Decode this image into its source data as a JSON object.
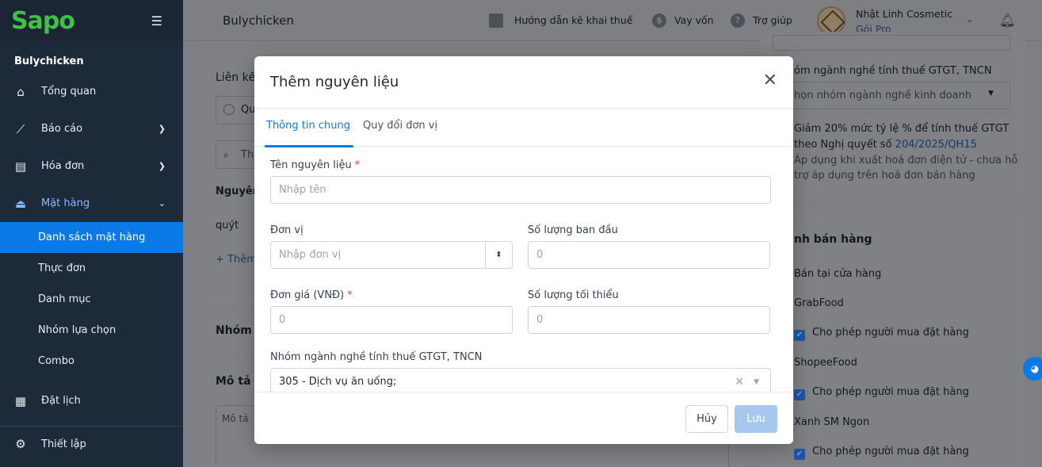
{
  "sidebar": {
    "logo": "Sapo",
    "store_name": "Bulychicken",
    "items": [
      {
        "label": "Tổng quan",
        "icon": "home-icon"
      },
      {
        "label": "Báo cáo",
        "icon": "chart-icon"
      },
      {
        "label": "Hóa đơn",
        "icon": "invoice-icon"
      },
      {
        "label": "Mặt hàng",
        "icon": "product-icon"
      }
    ],
    "subitems": [
      "Danh sách mặt hàng",
      "Thực đơn",
      "Danh mục",
      "Nhóm lựa chọn",
      "Combo"
    ],
    "bottom": [
      {
        "label": "Đặt lịch",
        "icon": "calendar-icon"
      },
      {
        "label": "Thiết lập",
        "icon": "gear-icon"
      }
    ]
  },
  "header": {
    "store": "Bulychicken",
    "tax_guide": "Hướng dẫn kê khai thuế",
    "loan": "Vay vốn",
    "help": "Trợ giúp",
    "user_name": "Nhật Linh Cosmetic",
    "user_plan": "Gói Pro"
  },
  "background": {
    "section_link": "Liên kế",
    "radio_label": "Qu",
    "search_placeholder": "Th",
    "col_ingredient": "Nguyên",
    "row_value": "quýt",
    "add_link": "+ Thêm",
    "group_title": "Nhóm",
    "desc_title": "Mô tả",
    "desc_placeholder": "Mô tả",
    "right_label": "óm ngành nghề tính thuế GTGT, TNCN",
    "right_select": "họn nhóm ngành nghề kinh doanh",
    "right_note_1": "Giảm 20% mức tỷ lệ % để tính thuế GTGT",
    "right_note_2": "theo Nghị quyết số",
    "right_note_link": "204/2025/QH15",
    "right_note_3": "Áp dụng khi xuất hoá đơn điện tử - chưa hỗ",
    "right_note_4": "trợ áp dụng trên hoá đơn bán hàng",
    "sale_title": "nh bán hàng",
    "sale_items": [
      "Bán tại cửa hàng",
      "GrabFood",
      "Cho phép người mua đặt hàng",
      "ShopeeFood",
      "Cho phép người mua đặt hàng",
      "Xanh SM Ngon",
      "Cho phép người mua đặt hàng"
    ]
  },
  "modal": {
    "title": "Thêm nguyên liệu",
    "tabs": [
      "Thông tin chung",
      "Quy đổi đơn vị"
    ],
    "name_label": "Tên nguyên liệu",
    "name_placeholder": "Nhập tên",
    "unit_label": "Đơn vị",
    "unit_placeholder": "Nhập đơn vị",
    "init_qty_label": "Số lượng ban đầu",
    "init_qty_value": "0",
    "price_label": "Đơn giá (VNĐ)",
    "price_value": "0",
    "min_qty_label": "Số lượng tối thiểu",
    "min_qty_value": "0",
    "tax_group_label": "Nhóm ngành nghề tính thuế GTGT, TNCN",
    "tax_group_value": "305 - Dịch vụ ăn uống;",
    "required_mark": "*",
    "cancel": "Hủy",
    "save": "Lưu"
  }
}
